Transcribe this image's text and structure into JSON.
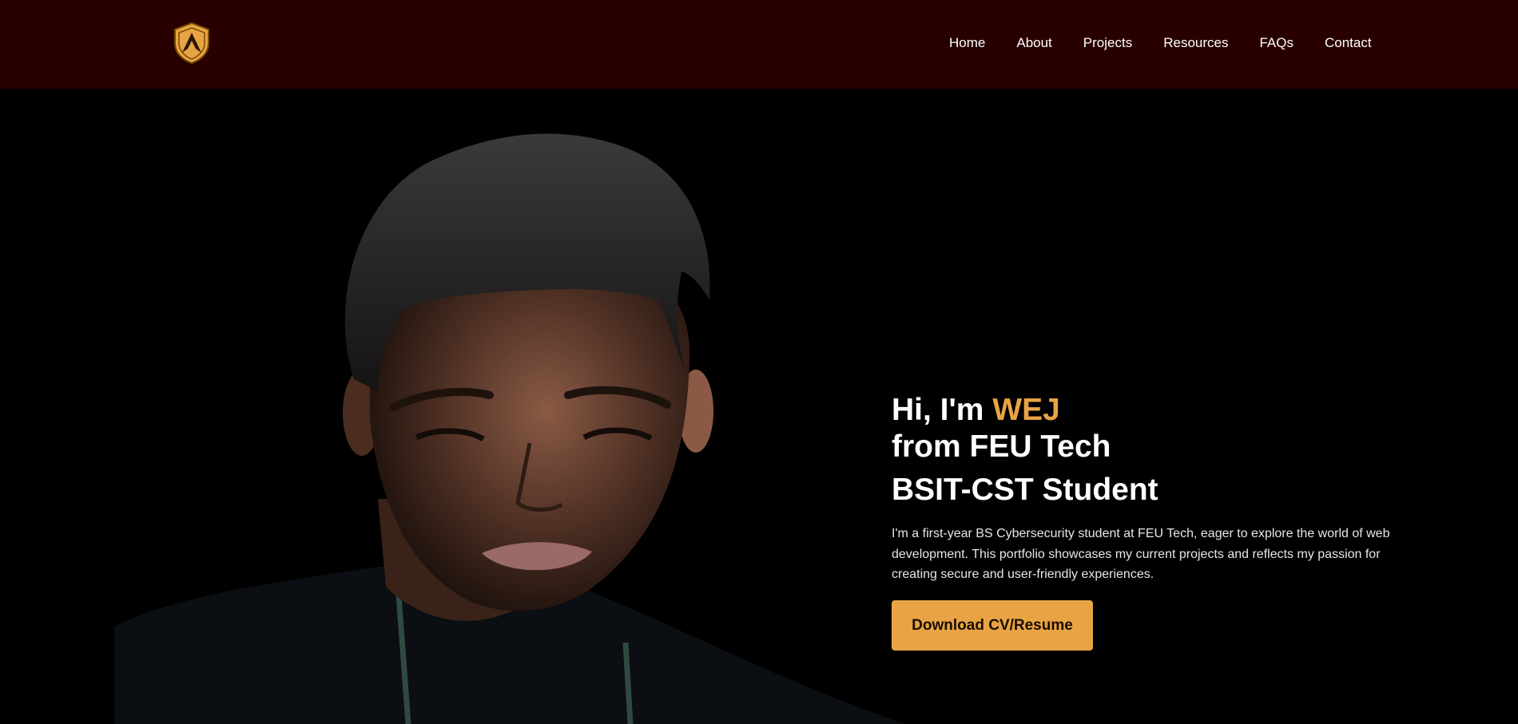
{
  "nav": {
    "logo_name": "shield-logo-icon",
    "items": [
      {
        "label": "Home"
      },
      {
        "label": "About"
      },
      {
        "label": "Projects"
      },
      {
        "label": "Resources"
      },
      {
        "label": "FAQs"
      },
      {
        "label": "Contact"
      }
    ]
  },
  "hero": {
    "greeting": "Hi, I'm ",
    "name": "WEJ",
    "line2": "from FEU Tech",
    "line3": "BSIT-CST Student",
    "intro": "I'm a first-year BS Cybersecurity student at FEU Tech, eager to explore the world of web development. This portfolio showcases my current projects and reflects my passion for creating secure and user-friendly experiences.",
    "cta_label": "Download CV/Resume"
  },
  "colors": {
    "navbar_bg": "#280000",
    "page_bg": "#000000",
    "accent": "#e8a444",
    "text": "#ffffff"
  }
}
